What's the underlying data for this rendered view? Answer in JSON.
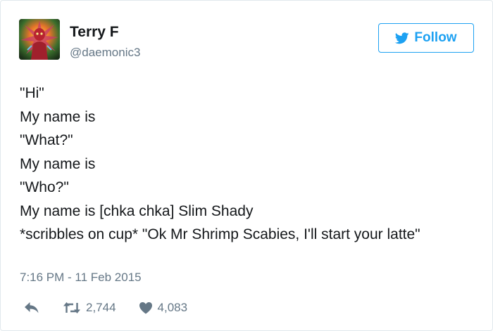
{
  "tweet": {
    "author": {
      "display_name": "Terry F",
      "handle": "@daemonic3",
      "avatar_icon": "avatar-image"
    },
    "follow_button": {
      "label": "Follow",
      "icon": "twitter-bird-icon",
      "accent_color": "#1da1f2"
    },
    "text_lines": [
      "\"Hi\"",
      "My name is",
      "\"What?\"",
      "My name is",
      "\"Who?\"",
      "My name is [chka chka] Slim Shady",
      "*scribbles on cup* \"Ok Mr Shrimp Scabies, I'll start your latte\""
    ],
    "timestamp": "7:16 PM - 11 Feb 2015",
    "actions": {
      "reply_icon": "reply-icon",
      "retweet_icon": "retweet-icon",
      "retweet_count": "2,744",
      "like_icon": "heart-icon",
      "like_count": "4,083"
    },
    "colors": {
      "text": "#14171a",
      "secondary_text": "#657786",
      "border": "#e1e8ed"
    }
  }
}
